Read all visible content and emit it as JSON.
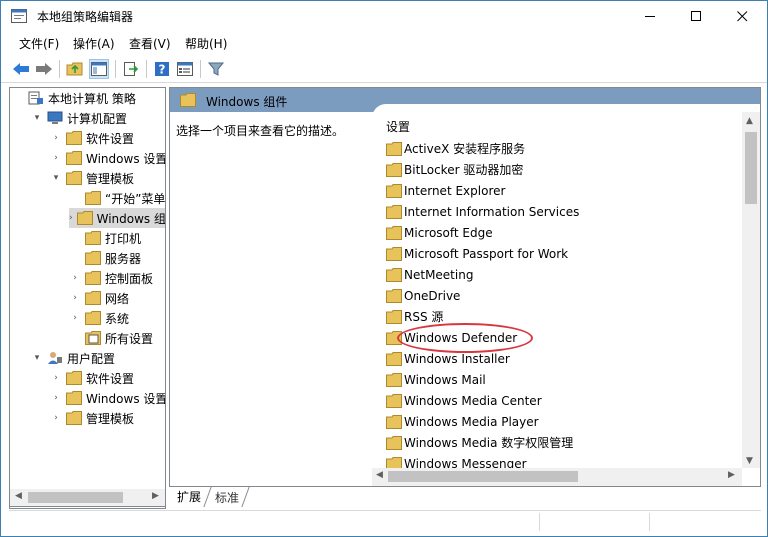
{
  "window": {
    "title": "本地组策略编辑器"
  },
  "menu": [
    "文件(F)",
    "操作(A)",
    "查看(V)",
    "帮助(H)"
  ],
  "tree": [
    {
      "label": "本地计算机 策略",
      "depth": 0,
      "exp": "",
      "icon": "computer-policy-icon"
    },
    {
      "label": "计算机配置",
      "depth": 1,
      "exp": "▾",
      "icon": "computer-icon"
    },
    {
      "label": "软件设置",
      "depth": 2,
      "exp": "›",
      "icon": "folder-icon"
    },
    {
      "label": "Windows 设置",
      "depth": 2,
      "exp": "›",
      "icon": "folder-icon"
    },
    {
      "label": "管理模板",
      "depth": 2,
      "exp": "▾",
      "icon": "folder-icon"
    },
    {
      "label": "“开始”菜单和",
      "depth": 3,
      "exp": "",
      "icon": "folder-icon"
    },
    {
      "label": "Windows 组件",
      "depth": 3,
      "exp": "›",
      "icon": "folder-icon",
      "selected": true
    },
    {
      "label": "打印机",
      "depth": 3,
      "exp": "",
      "icon": "folder-icon"
    },
    {
      "label": "服务器",
      "depth": 3,
      "exp": "",
      "icon": "folder-icon"
    },
    {
      "label": "控制面板",
      "depth": 3,
      "exp": "›",
      "icon": "folder-icon"
    },
    {
      "label": "网络",
      "depth": 3,
      "exp": "›",
      "icon": "folder-icon"
    },
    {
      "label": "系统",
      "depth": 3,
      "exp": "›",
      "icon": "folder-icon"
    },
    {
      "label": "所有设置",
      "depth": 3,
      "exp": "",
      "icon": "settings-page-icon"
    },
    {
      "label": "用户配置",
      "depth": 1,
      "exp": "▾",
      "icon": "user-icon"
    },
    {
      "label": "软件设置",
      "depth": 2,
      "exp": "›",
      "icon": "folder-icon"
    },
    {
      "label": "Windows 设置",
      "depth": 2,
      "exp": "›",
      "icon": "folder-icon"
    },
    {
      "label": "管理模板",
      "depth": 2,
      "exp": "›",
      "icon": "folder-icon"
    }
  ],
  "right": {
    "header": "Windows 组件",
    "description": "选择一个项目来查看它的描述。",
    "column_header": "设置",
    "items": [
      "ActiveX 安装程序服务",
      "BitLocker 驱动器加密",
      "Internet Explorer",
      "Internet Information Services",
      "Microsoft Edge",
      "Microsoft Passport for Work",
      "NetMeeting",
      "OneDrive",
      "RSS 源",
      "Windows Defender",
      "Windows Installer",
      "Windows Mail",
      "Windows Media Center",
      "Windows Media Player",
      "Windows Media 数字权限管理",
      "Windows Messenger"
    ]
  },
  "tabs": {
    "extended": "扩展",
    "standard": "标准"
  },
  "colors": {
    "header_band": "#7c9cbf",
    "selection": "#d9d9d9",
    "highlight": "#d9363e",
    "folder": "#e8c25a"
  }
}
